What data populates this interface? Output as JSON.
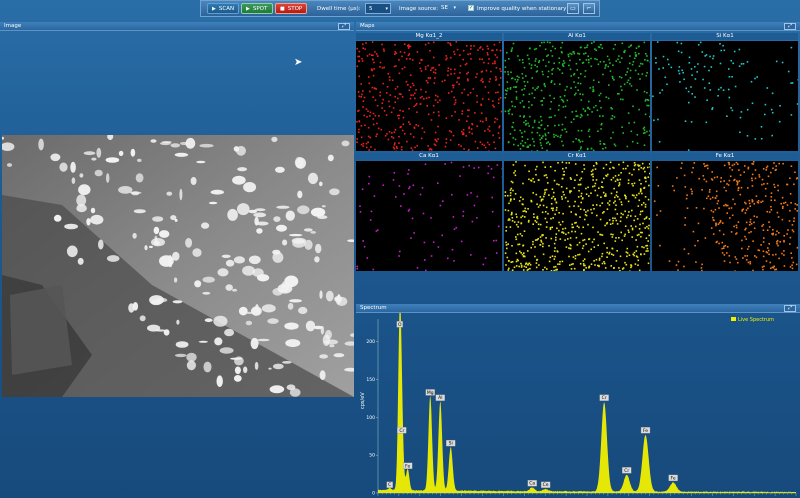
{
  "toolbar": {
    "scan_label": "SCAN",
    "spot_label": "SPOT",
    "stop_label": "STOP",
    "dwell_label": "Dwell time (µs):",
    "dwell_value": "5",
    "source_label": "Image source:",
    "source_value": "SE",
    "improve_label": "Improve quality when stationary",
    "improve_checked": true
  },
  "panels": {
    "image_title": "Image",
    "maps_title": "Maps",
    "spectrum_title": "Spectrum"
  },
  "maps": [
    {
      "label": "Mg Kα1_2",
      "color": "#e8231a"
    },
    {
      "label": "Al Kα1",
      "color": "#22b82a"
    },
    {
      "label": "Si Kα1",
      "color": "#20c8c8"
    },
    {
      "label": "Ca Kα1",
      "color": "#c81ec8"
    },
    {
      "label": "Cr Kα1",
      "color": "#e6e21c"
    },
    {
      "label": "Fe Kα1",
      "color": "#f07818"
    }
  ],
  "chart_data": {
    "type": "line",
    "ylabel": "cps/eV",
    "yticks": [
      0,
      50,
      100,
      150,
      200
    ],
    "ylim": [
      0,
      230
    ],
    "xlim": [
      0,
      10
    ],
    "legend": "Live Spectrum",
    "series_color": "#f0f000",
    "peaks": [
      {
        "label": "C",
        "x": 0.28,
        "y": 3
      },
      {
        "label": "O",
        "x": 0.52,
        "y": 215
      },
      {
        "label": "Cr",
        "x": 0.57,
        "y": 75
      },
      {
        "label": "Fe",
        "x": 0.71,
        "y": 28
      },
      {
        "label": "Mg",
        "x": 1.25,
        "y": 125
      },
      {
        "label": "Al",
        "x": 1.49,
        "y": 118
      },
      {
        "label": "Si",
        "x": 1.74,
        "y": 58
      },
      {
        "label": "Ca",
        "x": 3.69,
        "y": 5
      },
      {
        "label": "Ce",
        "x": 4.01,
        "y": 3
      },
      {
        "label": "Cr",
        "x": 5.41,
        "y": 118
      },
      {
        "label": "Cr",
        "x": 5.95,
        "y": 22
      },
      {
        "label": "Fe",
        "x": 6.4,
        "y": 75
      },
      {
        "label": "Fe",
        "x": 7.06,
        "y": 12
      }
    ]
  }
}
